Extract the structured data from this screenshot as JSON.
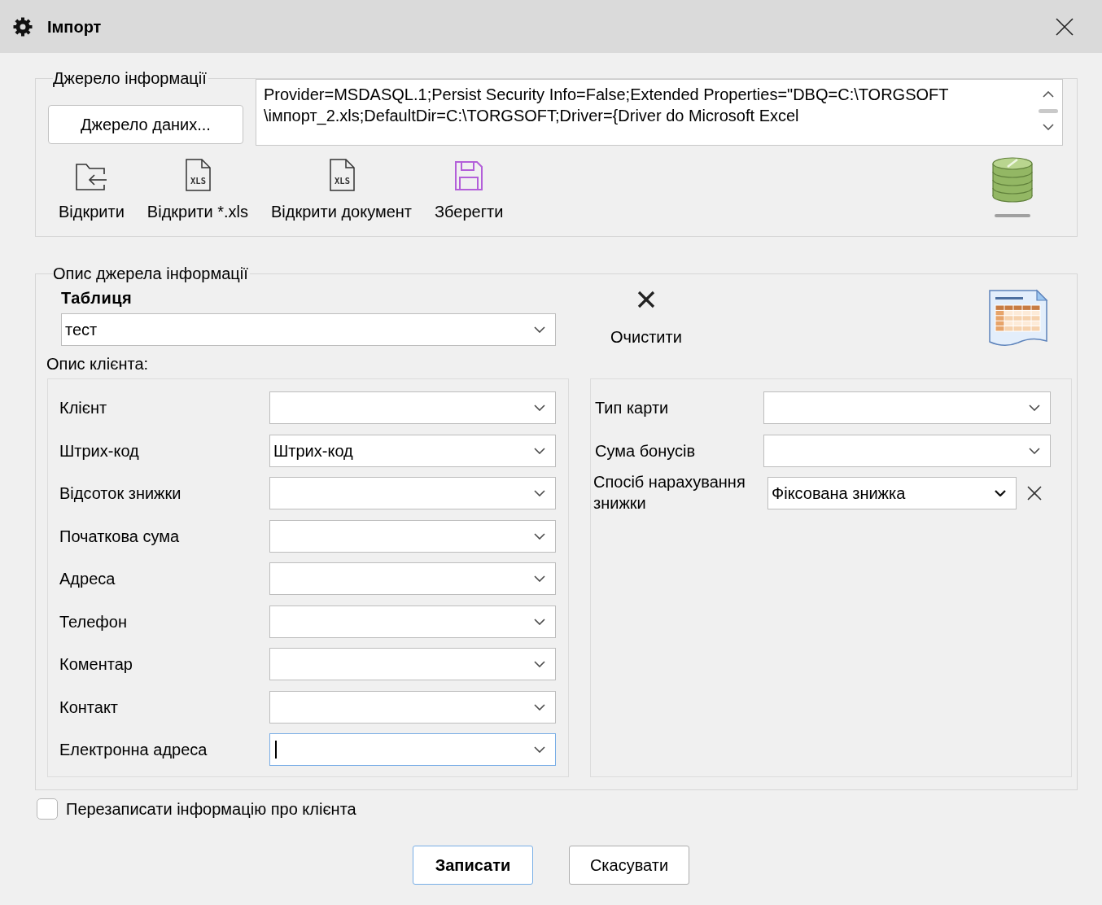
{
  "window": {
    "title": "Імпорт"
  },
  "source_group": {
    "title": "Джерело інформації",
    "source_button": "Джерело даних...",
    "connection_string": [
      "Provider=MSDASQL.1;Persist Security Info=False;Extended Properties=\"DBQ=C:\\TORGSOFT",
      "\\імпорт_2.xls;DefaultDir=C:\\TORGSOFT;Driver={Driver do Microsoft Excel"
    ],
    "toolbar": [
      {
        "kind": "open",
        "label": "Відкрити"
      },
      {
        "kind": "xls",
        "label": "Відкрити *.xls",
        "icon_text": "XLS"
      },
      {
        "kind": "xls",
        "label": "Відкрити документ",
        "icon_text": "XLS"
      },
      {
        "kind": "save",
        "label": "Зберегти"
      }
    ]
  },
  "description_group": {
    "title": "Опис джерела інформації",
    "table_label": "Таблиця",
    "table_value": "тест",
    "clear_button": "Очистити",
    "client_label": "Опис клієнта:",
    "left_fields": [
      {
        "label": "Клієнт",
        "focused": false
      },
      {
        "label": "Штрих-код",
        "value": "Штрих-код",
        "focused": false
      },
      {
        "label": "Відсоток знижки",
        "focused": false
      },
      {
        "label": "Початкова сума",
        "focused": false
      },
      {
        "label": "Адреса",
        "focused": false
      },
      {
        "label": "Телефон",
        "focused": false
      },
      {
        "label": "Коментар",
        "focused": false
      },
      {
        "label": "Контакт",
        "focused": false
      },
      {
        "label": "Електронна адреса",
        "focused": true
      }
    ],
    "right_fields": [
      {
        "label": "Тип карти",
        "clear": false
      },
      {
        "label": "Сума бонусів",
        "clear": false
      },
      {
        "label": "Спосіб нарахування знижки",
        "value": "Фіксована знижка",
        "clear": true
      }
    ]
  },
  "overwrite_checkbox": {
    "label": "Перезаписати інформацію про клієнта",
    "checked": false
  },
  "buttons": [
    {
      "label": "Записати",
      "default": true
    },
    {
      "label": "Скасувати",
      "default": false
    }
  ]
}
